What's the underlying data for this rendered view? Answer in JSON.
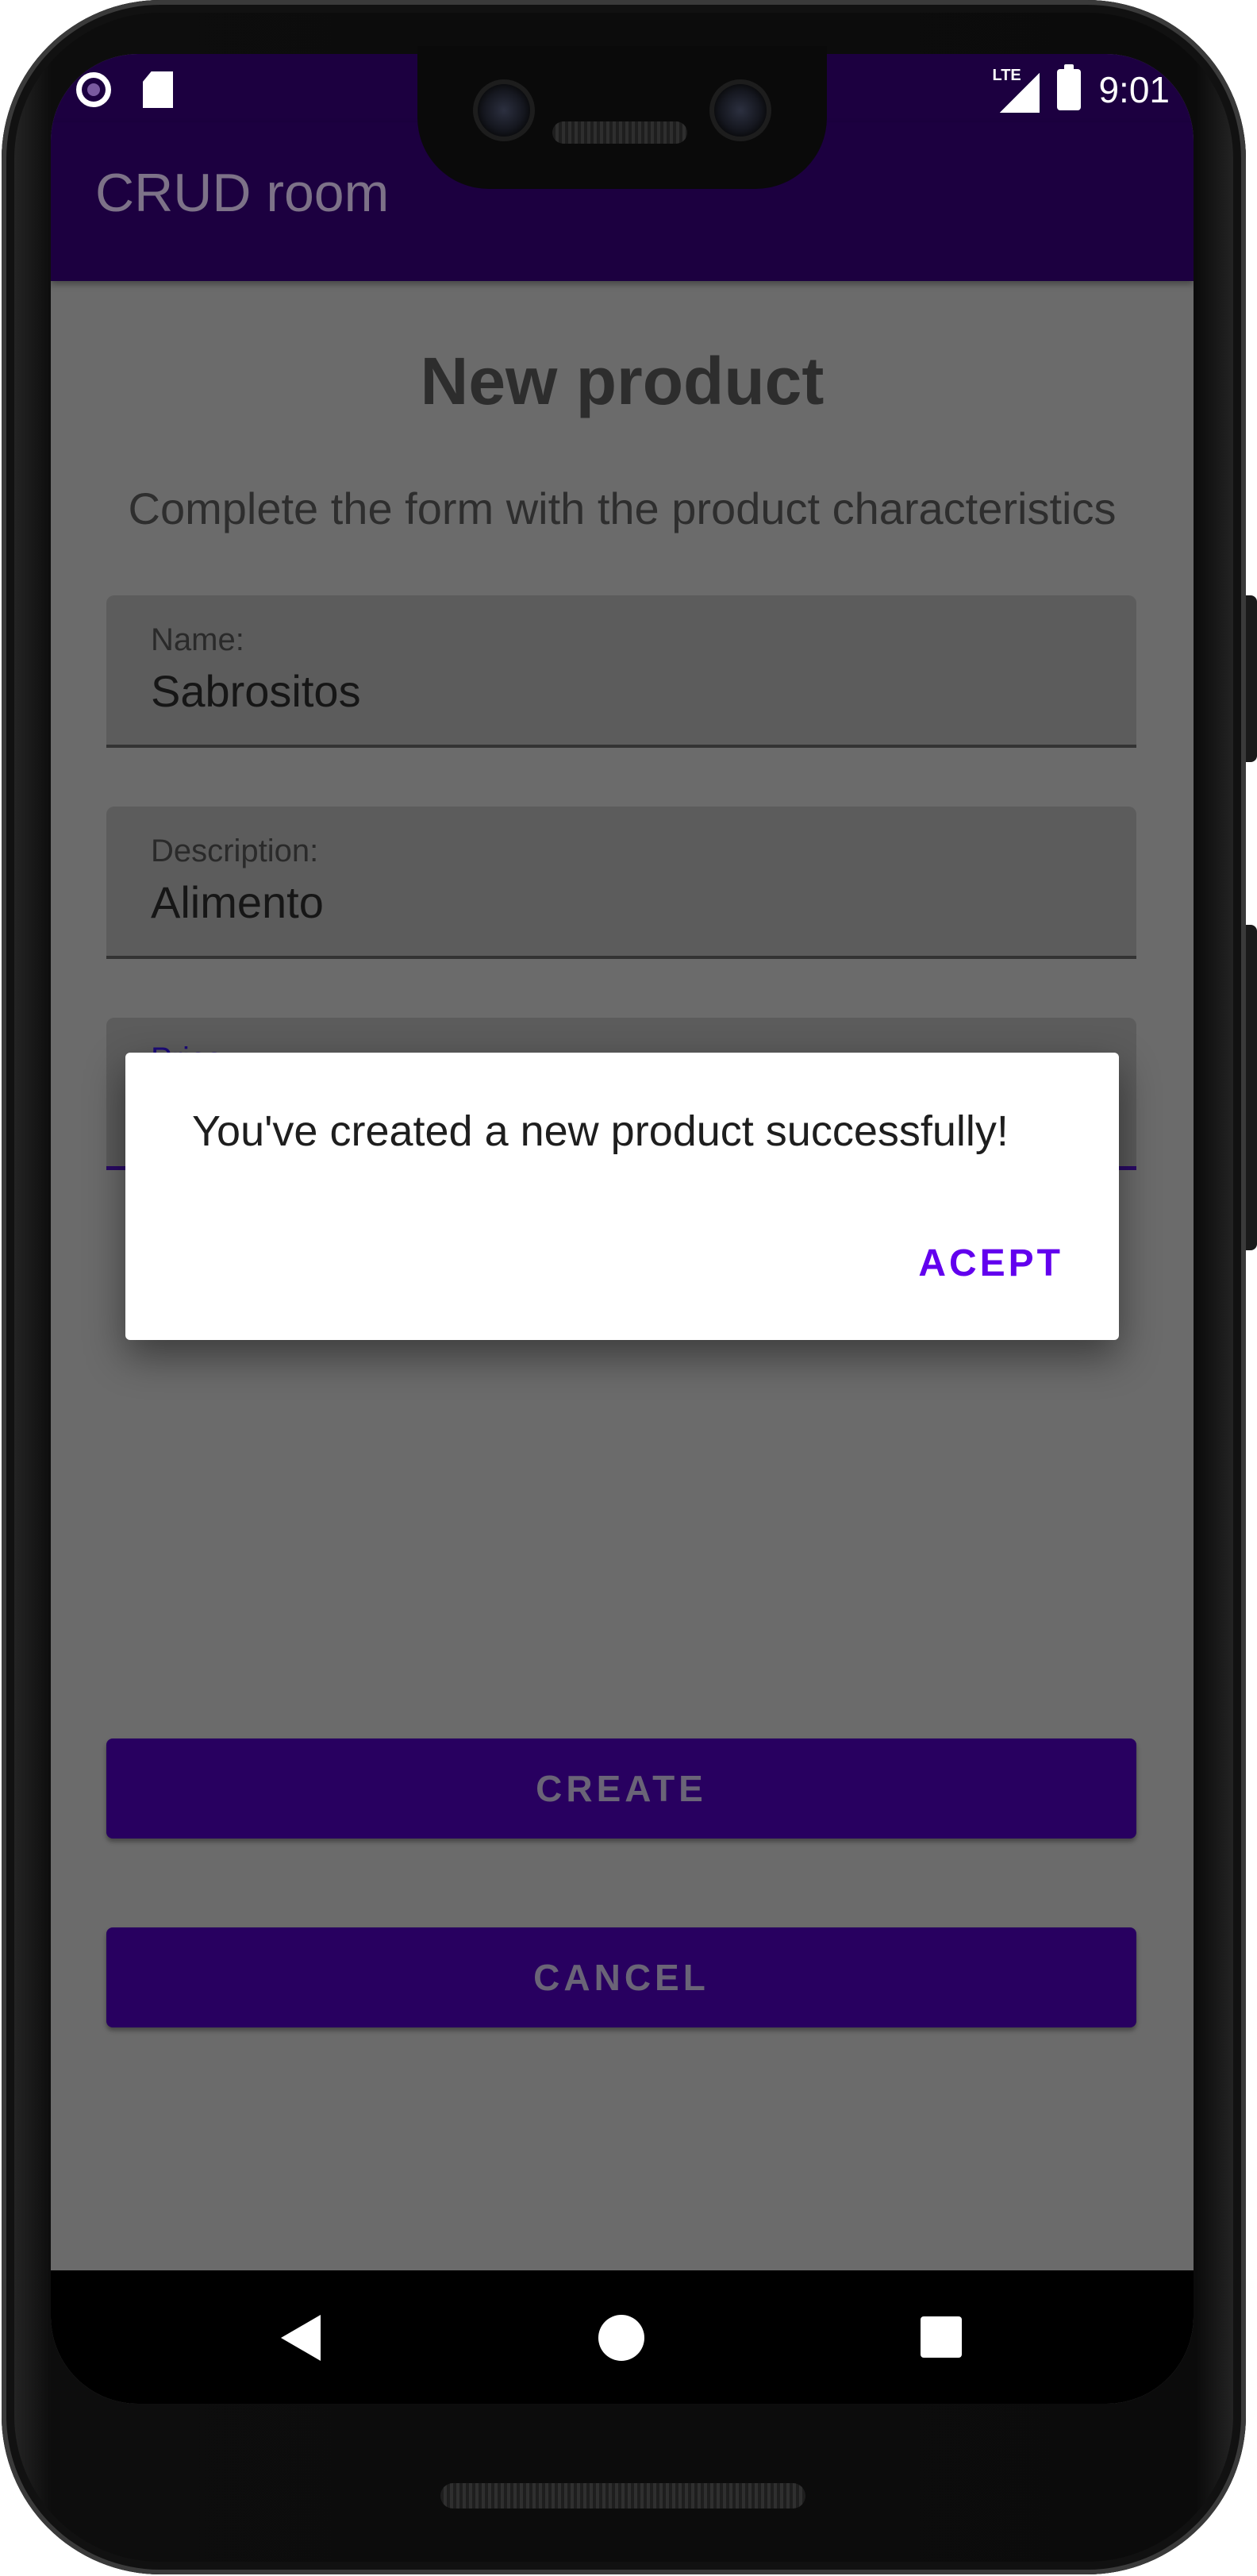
{
  "status_bar": {
    "time": "9:01",
    "network_label": "LTE"
  },
  "app_bar": {
    "title": "CRUD room"
  },
  "form": {
    "heading": "New product",
    "subtitle": "Complete the form with the product characteristics",
    "fields": [
      {
        "label": "Name:",
        "value": "Sabrositos"
      },
      {
        "label": "Description:",
        "value": "Alimento"
      },
      {
        "label": "Price:",
        "value": ""
      }
    ],
    "create_label": "CREATE",
    "cancel_label": "CANCEL"
  },
  "dialog": {
    "message": "You've created a new product successfully!",
    "accept_label": "ACEPT"
  },
  "colors": {
    "primary": "#1c0040",
    "accent": "#6200ee",
    "scrim_background": "#6b6b6b",
    "dialog_background": "#ffffff"
  },
  "icons": {
    "status_left": [
      "record-icon",
      "sd-card-icon"
    ],
    "status_right": [
      "lte-signal-icon",
      "battery-icon"
    ],
    "navigation": [
      "back-icon",
      "home-icon",
      "recents-icon"
    ]
  }
}
